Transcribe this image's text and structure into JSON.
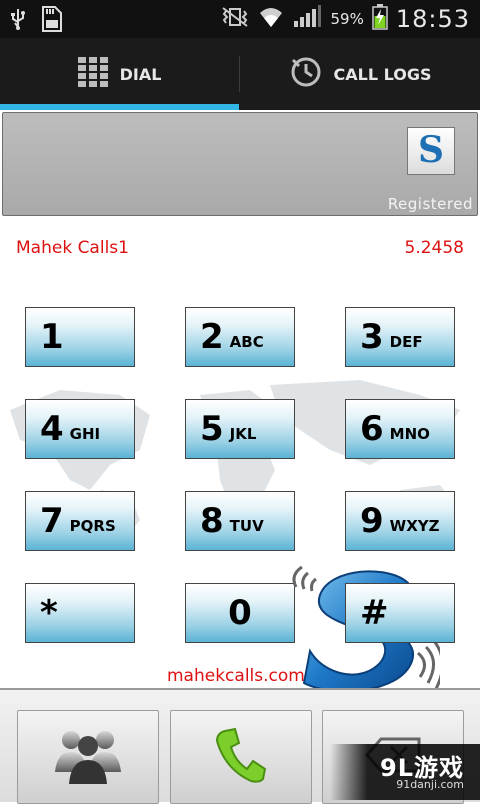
{
  "status_bar": {
    "battery_percent": "59%",
    "time": "18:53",
    "icons": [
      "usb-icon",
      "sd-card-icon",
      "vibrate-icon",
      "wifi-icon",
      "signal-icon",
      "battery-charging-icon"
    ]
  },
  "tabs": [
    {
      "label": "DIAL",
      "selected": true,
      "icon": "dialpad-icon"
    },
    {
      "label": "CALL LOGS",
      "selected": false,
      "icon": "call-logs-icon"
    }
  ],
  "display": {
    "registration_status": "Registered",
    "logo_letter": "S"
  },
  "account": {
    "name": "Mahek Calls1",
    "balance": "5.2458"
  },
  "keypad": [
    {
      "digit": "1",
      "letters": ""
    },
    {
      "digit": "2",
      "letters": "ABC"
    },
    {
      "digit": "3",
      "letters": "DEF"
    },
    {
      "digit": "4",
      "letters": "GHI"
    },
    {
      "digit": "5",
      "letters": "JKL"
    },
    {
      "digit": "6",
      "letters": "MNO"
    },
    {
      "digit": "7",
      "letters": "PQRS"
    },
    {
      "digit": "8",
      "letters": "TUV"
    },
    {
      "digit": "9",
      "letters": "WXYZ"
    },
    {
      "digit": "*",
      "letters": ""
    },
    {
      "digit": "0",
      "letters": ""
    },
    {
      "digit": "#",
      "letters": ""
    }
  ],
  "website": "mahekcalls.com",
  "bottom_buttons": [
    {
      "icon": "contacts-icon"
    },
    {
      "icon": "call-icon"
    },
    {
      "icon": "backspace-icon"
    }
  ],
  "watermark": {
    "main": "9L游戏",
    "sub": "91danji.com"
  },
  "colors": {
    "accent": "#33b5e5",
    "info_red": "#dd1111",
    "key_blue": "#5bb3d4",
    "call_green": "#7ccf2a"
  }
}
